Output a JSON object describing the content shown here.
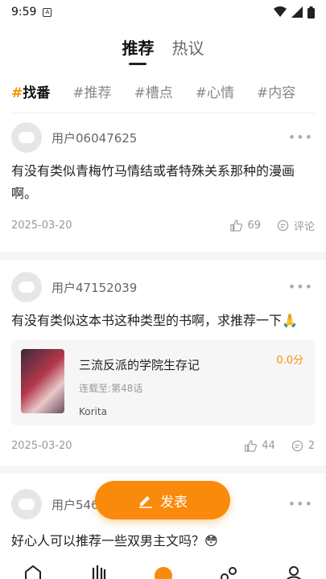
{
  "status_bar": {
    "time": "9:59",
    "sim_label": "A"
  },
  "top_tabs": [
    {
      "label": "推荐",
      "active": true
    },
    {
      "label": "热议",
      "active": false
    }
  ],
  "sub_tabs": [
    {
      "hash": "#",
      "label": "找番",
      "active": true
    },
    {
      "hash": "#",
      "label": "推荐",
      "active": false
    },
    {
      "hash": "#",
      "label": "槽点",
      "active": false
    },
    {
      "hash": "#",
      "label": "心情",
      "active": false
    },
    {
      "hash": "#",
      "label": "内容",
      "active": false
    }
  ],
  "posts": [
    {
      "user": "用户06047625",
      "text": "有没有类似青梅竹马情结或者特殊关系那种的漫画啊。",
      "date": "2025-03-20",
      "likes": "69",
      "comment_label": "评论"
    },
    {
      "user": "用户47152039",
      "text": "有没有类似这本书这种类型的书啊，求推荐一下🙏",
      "date": "2025-03-20",
      "likes": "44",
      "comments": "2",
      "book": {
        "title": "三流反派的学院生存记",
        "chapter": "连载至:第48话",
        "author": "Korita",
        "score": "0.0分"
      }
    },
    {
      "user": "用户54635464",
      "text": "好心人可以推荐一些双男主文吗？😳"
    }
  ],
  "fab_label": "发表",
  "more_glyph": "•••",
  "colors": {
    "accent": "#fa8a0c"
  }
}
